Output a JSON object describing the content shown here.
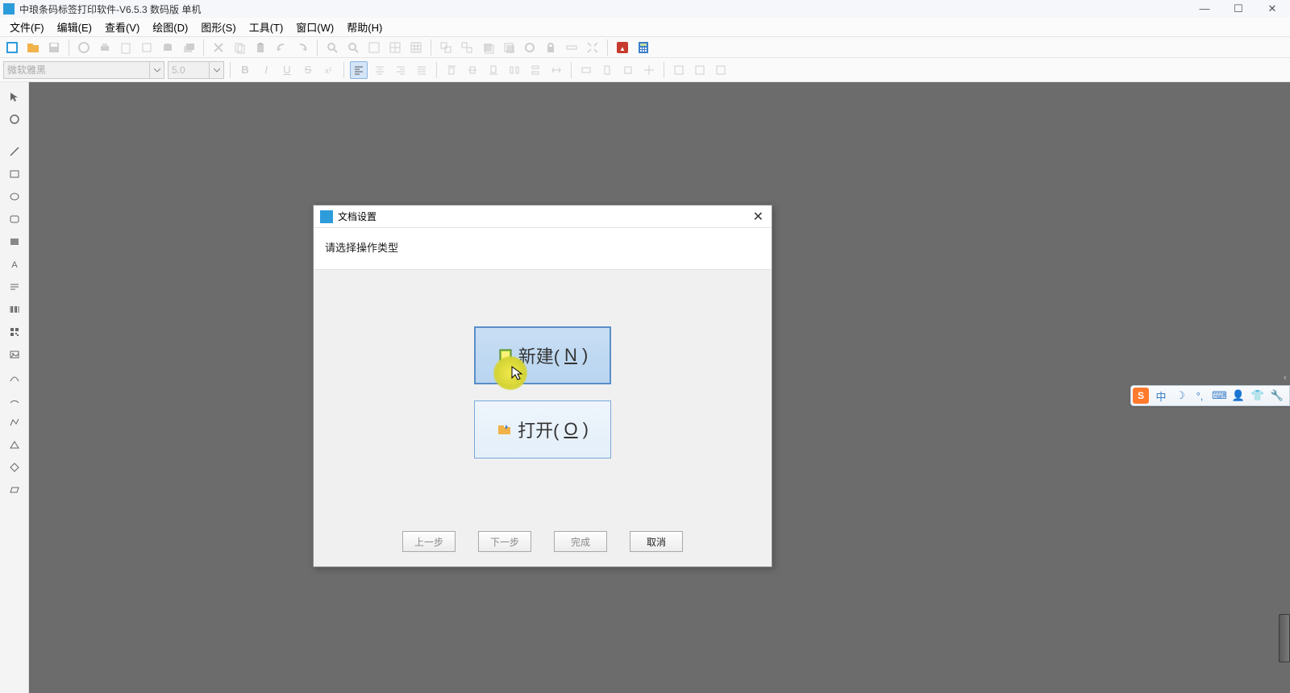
{
  "titlebar": {
    "title": "中琅条码标签打印软件-V6.5.3 数码版 单机"
  },
  "menu": {
    "file": "文件(F)",
    "edit": "编辑(E)",
    "view": "查看(V)",
    "draw": "绘图(D)",
    "shape": "图形(S)",
    "tool": "工具(T)",
    "window": "窗口(W)",
    "help": "帮助(H)"
  },
  "toolbar2": {
    "font_placeholder": "微软雅黑",
    "font_size": "5.0"
  },
  "dialog": {
    "title": "文档设置",
    "prompt": "请选择操作类型",
    "new_label_prefix": "新建(",
    "new_label_key": "N",
    "new_label_suffix": ")",
    "open_label_prefix": "打开(",
    "open_label_key": "O",
    "open_label_suffix": ")",
    "prev": "上一步",
    "next": "下一步",
    "finish": "完成",
    "cancel": "取消"
  },
  "ime": {
    "logo": "S",
    "lang": "中"
  }
}
